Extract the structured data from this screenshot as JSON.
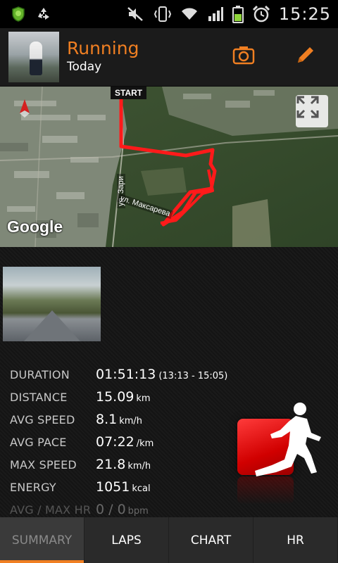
{
  "status_bar": {
    "time": "15:25"
  },
  "header": {
    "title": "Running",
    "subtitle": "Today",
    "accent_color": "#f07f22"
  },
  "map": {
    "start_label": "START",
    "street_1": "ул. Максарева",
    "street_2": "ул. Зари",
    "provider_logo": "Google",
    "route_color": "#ff1a1a"
  },
  "stats": [
    {
      "label": "DURATION",
      "value": "01:51:13",
      "unit": "",
      "extra": "(13:13 - 15:05)"
    },
    {
      "label": "DISTANCE",
      "value": "15.09",
      "unit": "km",
      "extra": ""
    },
    {
      "label": "AVG SPEED",
      "value": "8.1",
      "unit": "km/h",
      "extra": ""
    },
    {
      "label": "AVG PACE",
      "value": "07:22",
      "unit": "/km",
      "extra": ""
    },
    {
      "label": "MAX SPEED",
      "value": "21.8",
      "unit": "km/h",
      "extra": ""
    },
    {
      "label": "ENERGY",
      "value": "1051",
      "unit": "kcal",
      "extra": ""
    },
    {
      "label": "AVG / MAX HR",
      "value": "0 / 0",
      "unit": "bpm",
      "extra": ""
    }
  ],
  "tabs": [
    {
      "label": "SUMMARY",
      "active": true
    },
    {
      "label": "LAPS",
      "active": false
    },
    {
      "label": "CHART",
      "active": false
    },
    {
      "label": "HR",
      "active": false
    }
  ],
  "icons": {
    "status_left": [
      "app-shield-icon",
      "recycle-icon"
    ],
    "status_right": [
      "mute-icon",
      "vibrate-icon",
      "wifi-icon",
      "signal-icon",
      "battery-icon",
      "alarm-icon"
    ],
    "header": [
      "camera-icon",
      "edit-pencil-icon"
    ],
    "map": [
      "compass-icon",
      "fullscreen-icon"
    ],
    "workout": [
      "runner-icon"
    ]
  }
}
